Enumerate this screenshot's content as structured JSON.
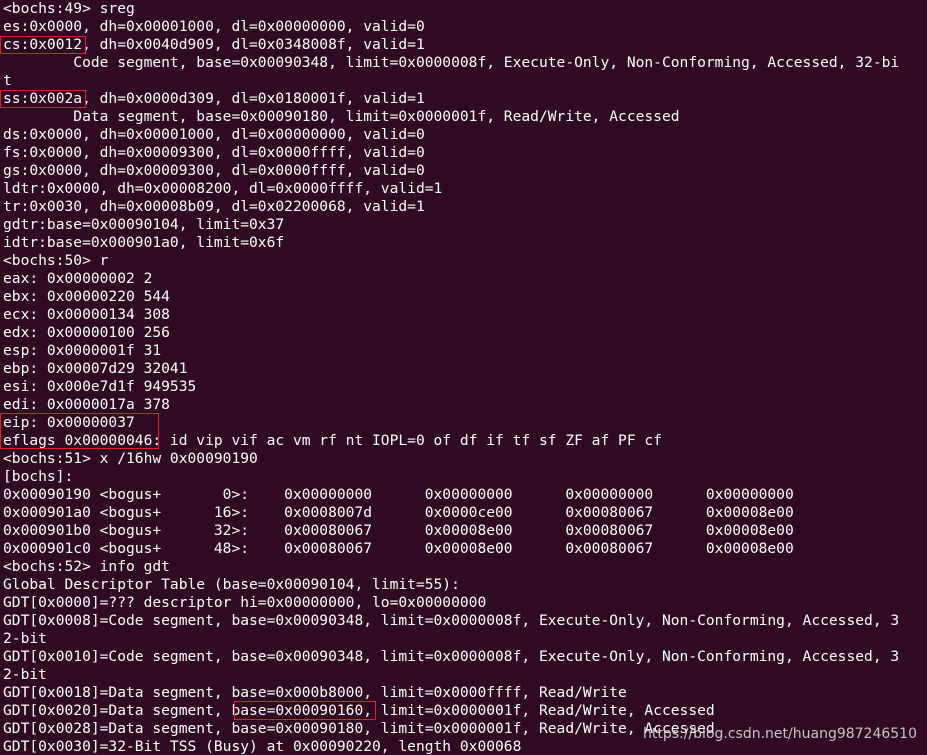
{
  "terminal": {
    "lines": [
      "<bochs:49> sreg",
      "es:0x0000, dh=0x00001000, dl=0x00000000, valid=0",
      "cs:0x0012, dh=0x0040d909, dl=0x0348008f, valid=1",
      "        Code segment, base=0x00090348, limit=0x0000008f, Execute-Only, Non-Conforming, Accessed, 32-bi",
      "t",
      "ss:0x002a, dh=0x0000d309, dl=0x0180001f, valid=1",
      "        Data segment, base=0x00090180, limit=0x0000001f, Read/Write, Accessed",
      "ds:0x0000, dh=0x00001000, dl=0x00000000, valid=0",
      "fs:0x0000, dh=0x00009300, dl=0x0000ffff, valid=0",
      "gs:0x0000, dh=0x00009300, dl=0x0000ffff, valid=0",
      "ldtr:0x0000, dh=0x00008200, dl=0x0000ffff, valid=1",
      "tr:0x0030, dh=0x00008b09, dl=0x02200068, valid=1",
      "gdtr:base=0x00090104, limit=0x37",
      "idtr:base=0x000901a0, limit=0x6f",
      "<bochs:50> r",
      "eax: 0x00000002 2",
      "ebx: 0x00000220 544",
      "ecx: 0x00000134 308",
      "edx: 0x00000100 256",
      "esp: 0x0000001f 31",
      "ebp: 0x00007d29 32041",
      "esi: 0x000e7d1f 949535",
      "edi: 0x0000017a 378",
      "eip: 0x00000037",
      "eflags 0x00000046: id vip vif ac vm rf nt IOPL=0 of df if tf sf ZF af PF cf",
      "<bochs:51> x /16hw 0x00090190",
      "[bochs]:",
      "0x00090190 <bogus+       0>:    0x00000000      0x00000000      0x00000000      0x00000000",
      "0x000901a0 <bogus+      16>:    0x0008007d      0x0000ce00      0x00080067      0x00008e00",
      "0x000901b0 <bogus+      32>:    0x00080067      0x00008e00      0x00080067      0x00008e00",
      "0x000901c0 <bogus+      48>:    0x00080067      0x00008e00      0x00080067      0x00008e00",
      "<bochs:52> info gdt",
      "Global Descriptor Table (base=0x00090104, limit=55):",
      "GDT[0x0000]=??? descriptor hi=0x00000000, lo=0x00000000",
      "GDT[0x0008]=Code segment, base=0x00090348, limit=0x0000008f, Execute-Only, Non-Conforming, Accessed, 3",
      "2-bit",
      "GDT[0x0010]=Code segment, base=0x00090348, limit=0x0000008f, Execute-Only, Non-Conforming, Accessed, 3",
      "2-bit",
      "GDT[0x0018]=Data segment, base=0x000b8000, limit=0x0000ffff, Read/Write",
      "GDT[0x0020]=Data segment, base=0x00090160, limit=0x0000001f, Read/Write, Accessed",
      "GDT[0x0028]=Data segment, base=0x00090180, limit=0x0000001f, Read/Write, Accessed",
      "GDT[0x0030]=32-Bit TSS (Busy) at 0x00090220, length 0x00068"
    ],
    "watermark": "https://blog.csdn.net/huang987246510",
    "colors": {
      "background": "#300a24",
      "text": "#ffffff",
      "highlight_box": "#e02020"
    }
  }
}
